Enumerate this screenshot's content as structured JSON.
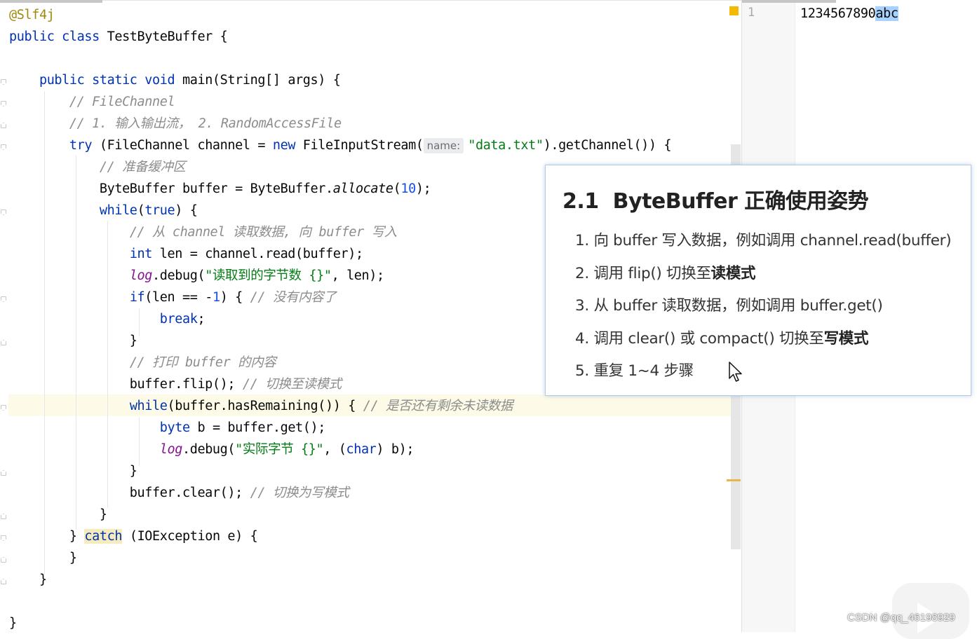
{
  "editor": {
    "lines": [
      [
        {
          "t": "@Slf4j",
          "c": "ann"
        }
      ],
      [
        {
          "t": "public class ",
          "c": "kw"
        },
        {
          "t": "TestByteBuffer {"
        }
      ],
      [],
      [
        {
          "t": "    "
        },
        {
          "t": "public static void ",
          "c": "kw"
        },
        {
          "t": "main(String[] args) {"
        }
      ],
      [
        {
          "t": "        "
        },
        {
          "t": "// FileChannel",
          "c": "cm"
        }
      ],
      [
        {
          "t": "        "
        },
        {
          "t": "// 1. 输入输出流， 2. RandomAccessFile",
          "c": "cm"
        }
      ],
      [
        {
          "t": "        "
        },
        {
          "t": "try ",
          "c": "kw"
        },
        {
          "t": "(FileChannel channel = "
        },
        {
          "t": "new ",
          "c": "kw"
        },
        {
          "t": "FileInputStream("
        },
        {
          "t": "name:",
          "c": "hint"
        },
        {
          "t": "\"data.txt\"",
          "c": "str"
        },
        {
          "t": ").getChannel()) {"
        }
      ],
      [
        {
          "t": "            "
        },
        {
          "t": "// 准备缓冲区",
          "c": "cm"
        }
      ],
      [
        {
          "t": "            ByteBuffer buffer = ByteBuffer."
        },
        {
          "t": "allocate",
          "c": "it"
        },
        {
          "t": "("
        },
        {
          "t": "10",
          "c": "num"
        },
        {
          "t": ");"
        }
      ],
      [
        {
          "t": "            "
        },
        {
          "t": "while",
          "c": "kw"
        },
        {
          "t": "("
        },
        {
          "t": "true",
          "c": "kw"
        },
        {
          "t": ") {"
        }
      ],
      [
        {
          "t": "                "
        },
        {
          "t": "// 从 channel 读取数据, 向 buffer 写入",
          "c": "cm"
        }
      ],
      [
        {
          "t": "                "
        },
        {
          "t": "int ",
          "c": "kw"
        },
        {
          "t": "len = channel.read(buffer);"
        }
      ],
      [
        {
          "t": "                "
        },
        {
          "t": "log",
          "c": "fld"
        },
        {
          "t": ".debug("
        },
        {
          "t": "\"读取到的字节数 {}\"",
          "c": "str"
        },
        {
          "t": ", len);"
        }
      ],
      [
        {
          "t": "                "
        },
        {
          "t": "if",
          "c": "kw"
        },
        {
          "t": "(len == -"
        },
        {
          "t": "1",
          "c": "num"
        },
        {
          "t": ") { "
        },
        {
          "t": "// 没有内容了",
          "c": "cm"
        }
      ],
      [
        {
          "t": "                    "
        },
        {
          "t": "break",
          "c": "kw"
        },
        {
          "t": ";"
        }
      ],
      [
        {
          "t": "                }"
        }
      ],
      [
        {
          "t": "                "
        },
        {
          "t": "// 打印 buffer 的内容",
          "c": "cm"
        }
      ],
      [
        {
          "t": "                buffer.flip(); "
        },
        {
          "t": "// 切换至读模式",
          "c": "cm"
        }
      ],
      [
        {
          "t": "                "
        },
        {
          "t": "while",
          "c": "kw"
        },
        {
          "t": "(buffer.hasRemaining()) { "
        },
        {
          "t": "// 是否还有剩余未读数据",
          "c": "cm"
        }
      ],
      [
        {
          "t": "                    "
        },
        {
          "t": "byte ",
          "c": "kw"
        },
        {
          "t": "b = buffer.get();"
        }
      ],
      [
        {
          "t": "                    "
        },
        {
          "t": "log",
          "c": "fld"
        },
        {
          "t": ".debug("
        },
        {
          "t": "\"实际字节 {}\"",
          "c": "str"
        },
        {
          "t": ", ("
        },
        {
          "t": "char",
          "c": "kw"
        },
        {
          "t": ") b);"
        }
      ],
      [
        {
          "t": "                }"
        }
      ],
      [
        {
          "t": "                buffer.clear(); "
        },
        {
          "t": "// 切换为写模式",
          "c": "cm"
        }
      ],
      [
        {
          "t": "            }"
        }
      ],
      [
        {
          "t": "        } "
        },
        {
          "t": "catch",
          "c": "kw catch-hl"
        },
        {
          "t": " (IOException e) {"
        }
      ],
      [
        {
          "t": "        }"
        }
      ],
      [
        {
          "t": "    }"
        }
      ],
      [],
      [
        {
          "t": "}"
        }
      ]
    ]
  },
  "data_file": {
    "line_number": "1",
    "text_plain": "1234567890",
    "text_selected": "abc"
  },
  "popup": {
    "title_number": "2.1",
    "title_text": "ByteBuffer 正确使用姿势",
    "steps": [
      {
        "prefix": "1. 向 buffer 写入数据，例如调用 channel.read(buffer)",
        "bold": ""
      },
      {
        "prefix": "2. 调用 flip() 切换至",
        "bold": "读模式"
      },
      {
        "prefix": "3. 从 buffer 读取数据，例如调用 buffer.get()",
        "bold": ""
      },
      {
        "prefix": "4. 调用 clear() 或 compact() 切换至",
        "bold": "写模式"
      },
      {
        "prefix": "5. 重复 1~4 步骤",
        "bold": ""
      }
    ]
  },
  "watermark": "CSDN @qq_46198929",
  "colors": {
    "keyword": "#0033b3",
    "annotation": "#9e880d",
    "comment": "#8c8c8c",
    "string": "#067d17",
    "number": "#1750eb",
    "field": "#871094",
    "selection": "#a6d2ff",
    "current_line": "#fdfbe7"
  },
  "icons": [
    "warning-marker-icon",
    "mouse-pointer-icon",
    "bilibili-play-icon",
    "fold-marker-icon"
  ]
}
